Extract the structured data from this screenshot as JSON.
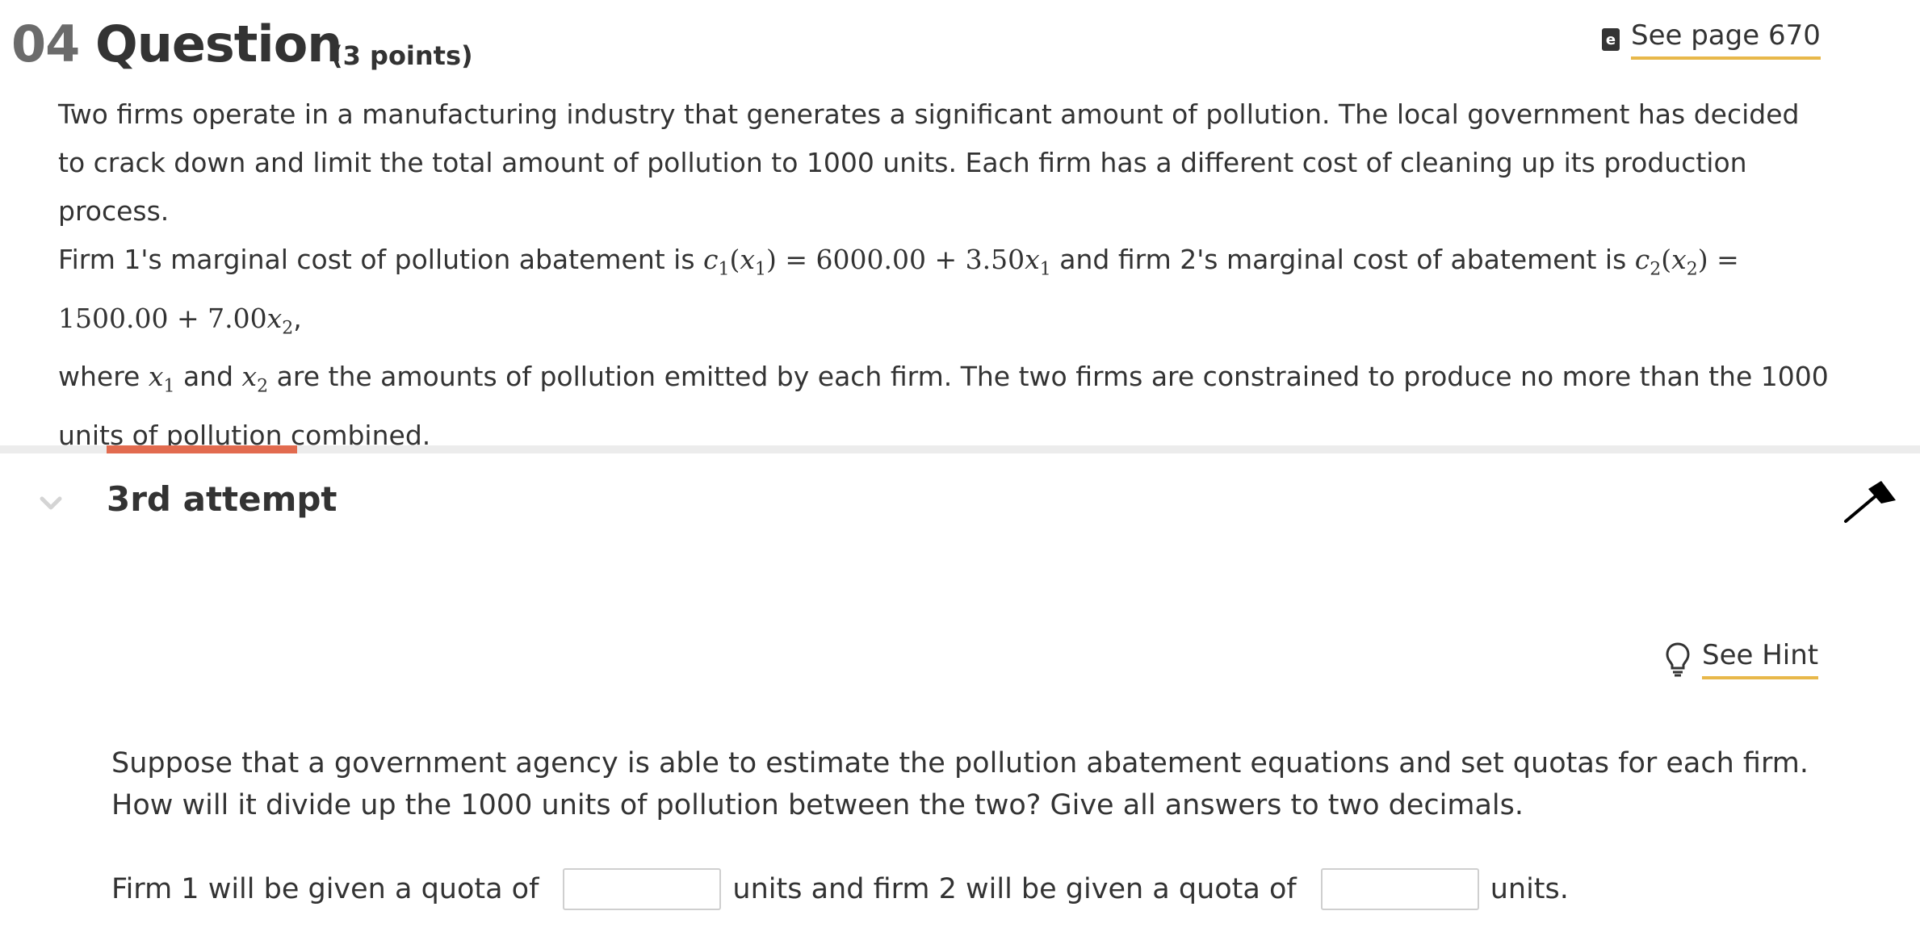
{
  "header": {
    "number": "04",
    "title": "Question",
    "points": "(3 points)",
    "see_page_label": "See page 670",
    "ebook_glyph": "e"
  },
  "problem": {
    "para1": "Two firms operate in a manufacturing industry that generates a significant amount of pollution. The local government has decided to crack down and limit the total amount of pollution to 1000 units. Each firm has a different cost of cleaning up its production process.",
    "para2": {
      "t1": "Firm 1's marginal cost of pollution abatement is ",
      "eq1": {
        "lhs": "c",
        "lsub": "1",
        "arg": "x",
        "asub": "1",
        "rhs_const": "6000.00",
        "plus": "+",
        "coef": "3.50",
        "var": "x",
        "vsub": "1"
      },
      "t2": " and firm 2's marginal cost of abatement is ",
      "eq2": {
        "lhs": "c",
        "lsub": "2",
        "arg": "x",
        "asub": "2",
        "rhs_const": "1500.00",
        "plus": "+",
        "coef": "7.00",
        "var": "x",
        "vsub": "2"
      },
      "t3": ",",
      "t4": "where ",
      "v1": "x",
      "v1sub": "1",
      "t5": " and ",
      "v2": "x",
      "v2sub": "2",
      "t6": " are the amounts of pollution emitted by each firm. The two firms are constrained to produce no more than the 1000 units of pollution combined."
    }
  },
  "attempt": {
    "label": "3rd attempt"
  },
  "hint": {
    "label": "See Hint"
  },
  "question": {
    "text": "Suppose that a government agency is able to estimate the pollution abatement equations and set quotas for each firm. How will it divide up the 1000 units of pollution between the two? Give all answers to two decimals.",
    "prefix": "Firm 1 will be given a quota of",
    "middle": "units and firm 2 will be given a quota of",
    "suffix": "units.",
    "firm1_value": "",
    "firm2_value": ""
  },
  "colors": {
    "accent": "#e26b4f",
    "link_underline": "#e8b84a",
    "text": "#333333",
    "number": "#6b6b6b"
  },
  "icons": [
    "ebook-icon",
    "chevron-down-icon",
    "cursor-arrow-icon",
    "lightbulb-icon"
  ]
}
